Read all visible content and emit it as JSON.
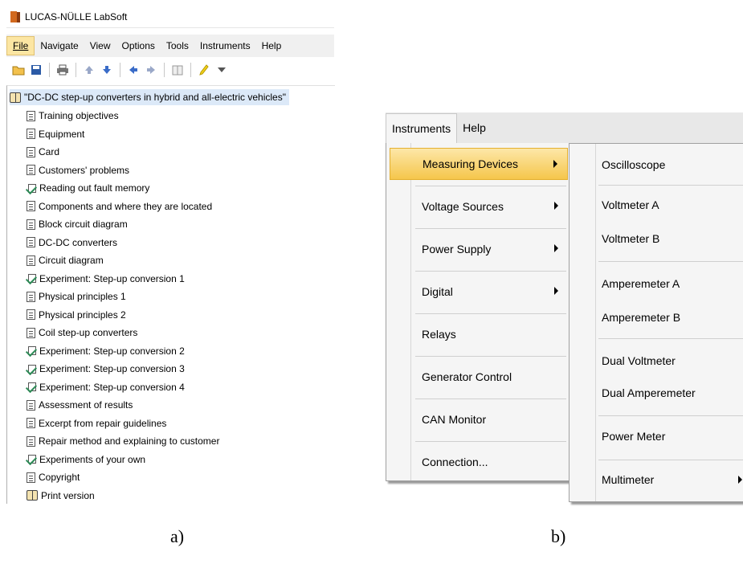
{
  "panel_a": {
    "title": "LUCAS-NÜLLE LabSoft",
    "menu": [
      {
        "label": "File"
      },
      {
        "label": "Navigate"
      },
      {
        "label": "View"
      },
      {
        "label": "Options"
      },
      {
        "label": "Tools"
      },
      {
        "label": "Instruments"
      },
      {
        "label": "Help"
      }
    ],
    "toolbar_icons": [
      "open-folder-icon",
      "save-icon",
      "print-icon",
      "arrow-up-icon",
      "arrow-down-icon",
      "arrow-left-icon",
      "arrow-right-icon",
      "book-icon",
      "pencil-icon",
      "dropdown-icon"
    ],
    "tree_root": "\"DC-DC step-up converters in hybrid and all-electric vehicles\"",
    "tree_items": [
      {
        "label": "Training objectives",
        "icon": "doc"
      },
      {
        "label": "Equipment",
        "icon": "doc"
      },
      {
        "label": "Card",
        "icon": "doc"
      },
      {
        "label": "Customers' problems",
        "icon": "doc"
      },
      {
        "label": "Reading out fault memory",
        "icon": "exp"
      },
      {
        "label": "Components and where they are located",
        "icon": "doc"
      },
      {
        "label": "Block circuit diagram",
        "icon": "doc"
      },
      {
        "label": "DC-DC converters",
        "icon": "doc"
      },
      {
        "label": "Circuit diagram",
        "icon": "doc"
      },
      {
        "label": "Experiment: Step-up conversion 1",
        "icon": "exp"
      },
      {
        "label": "Physical principles 1",
        "icon": "doc"
      },
      {
        "label": "Physical principles 2",
        "icon": "doc"
      },
      {
        "label": "Coil step-up converters",
        "icon": "doc"
      },
      {
        "label": "Experiment: Step-up conversion 2",
        "icon": "exp"
      },
      {
        "label": "Experiment: Step-up conversion 3",
        "icon": "exp"
      },
      {
        "label": "Experiment: Step-up conversion 4",
        "icon": "exp"
      },
      {
        "label": "Assessment of results",
        "icon": "doc"
      },
      {
        "label": "Excerpt from repair guidelines",
        "icon": "doc"
      },
      {
        "label": "Repair method and explaining to customer",
        "icon": "doc"
      },
      {
        "label": "Experiments of your own",
        "icon": "exp"
      },
      {
        "label": "Copyright",
        "icon": "doc"
      },
      {
        "label": "Print version",
        "icon": "book"
      }
    ],
    "caption": "a)"
  },
  "panel_b": {
    "menubar": [
      {
        "label": "Instruments"
      },
      {
        "label": "Help"
      }
    ],
    "menu_items": [
      {
        "label": "Measuring Devices",
        "submenu": true,
        "highlighted": true
      },
      {
        "label": "Voltage Sources",
        "submenu": true
      },
      {
        "label": "Power Supply",
        "submenu": true
      },
      {
        "label": "Digital",
        "submenu": true
      },
      {
        "label": "Relays",
        "submenu": false
      },
      {
        "label": "Generator Control",
        "submenu": false
      },
      {
        "label": "CAN Monitor",
        "submenu": false
      },
      {
        "label": "Connection...",
        "submenu": false
      }
    ],
    "submenu_items": [
      {
        "label": "Oscilloscope"
      },
      {
        "label": "Voltmeter A"
      },
      {
        "label": "Voltmeter B"
      },
      {
        "label": "Amperemeter A"
      },
      {
        "label": "Amperemeter B"
      },
      {
        "label": "Dual Voltmeter"
      },
      {
        "label": "Dual Amperemeter"
      },
      {
        "label": "Power Meter"
      },
      {
        "label": "Multimeter"
      }
    ],
    "caption": "b)"
  },
  "colors": {
    "highlight": "#f5c64b",
    "menubar_bg": "#f0f0f0",
    "selection": "#dce9f8"
  }
}
